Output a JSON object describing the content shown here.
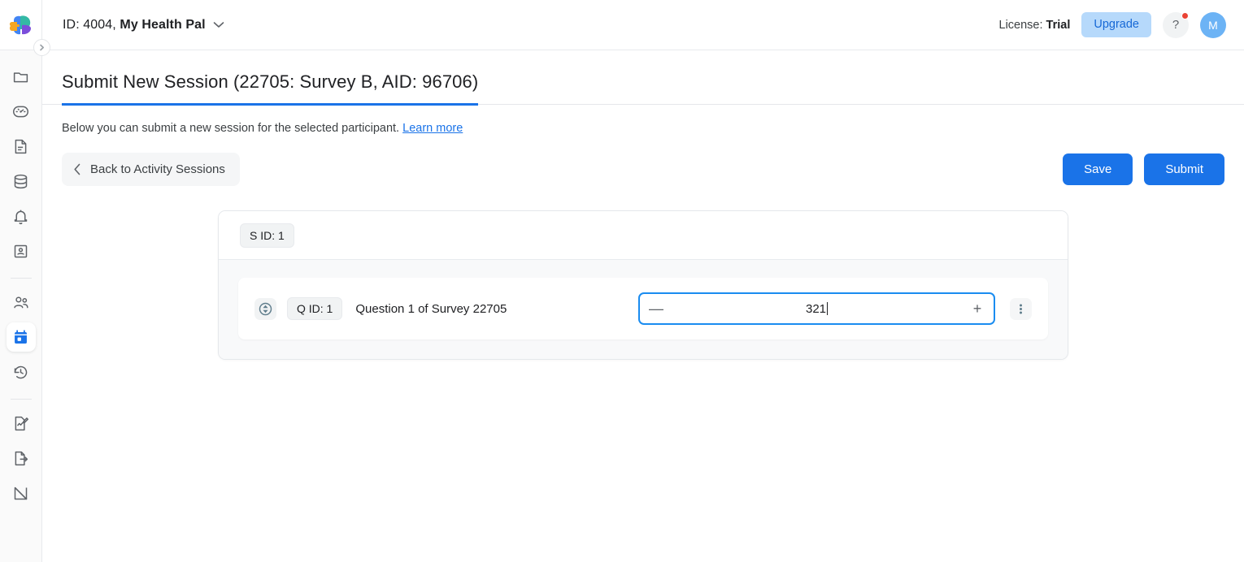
{
  "header": {
    "logo_icon": "brain-logo",
    "app_title_prefix": "ID: 4004,",
    "app_title_name": "My Health Pal",
    "dropdown_icon": "chevron-down-icon",
    "license_label": "License:",
    "license_value": "Trial",
    "upgrade_label": "Upgrade",
    "help_label": "?",
    "help_icon": "question-mark-icon",
    "avatar_initial": "M"
  },
  "sidebar": {
    "collapse_icon": "chevron-right-icon",
    "items": [
      {
        "name": "folder",
        "icon": "folder-icon",
        "active": false
      },
      {
        "name": "dashboard",
        "icon": "gauge-icon",
        "active": false
      },
      {
        "name": "documents",
        "icon": "document-icon",
        "active": false
      },
      {
        "name": "database",
        "icon": "database-icon",
        "active": false
      },
      {
        "name": "notifications",
        "icon": "bell-icon",
        "active": false
      },
      {
        "name": "participants",
        "icon": "id-card-icon",
        "active": false
      },
      {
        "name": "users",
        "icon": "users-icon",
        "active": false
      },
      {
        "name": "activity-sessions",
        "icon": "calendar-icon",
        "active": true
      },
      {
        "name": "history",
        "icon": "history-icon",
        "active": false
      },
      {
        "name": "edit-report",
        "icon": "document-edit-icon",
        "active": false
      },
      {
        "name": "export",
        "icon": "document-export-icon",
        "active": false
      },
      {
        "name": "analytics",
        "icon": "chart-icon",
        "active": false
      }
    ]
  },
  "page": {
    "title": "Submit New Session (22705: Survey B, AID: 96706)",
    "description": "Below you can submit a new session for the selected participant.",
    "learn_more_label": "Learn more",
    "back_label": "Back to Activity Sessions",
    "back_icon": "chevron-left-icon",
    "save_label": "Save",
    "submit_label": "Submit"
  },
  "session": {
    "session_badge": "S ID: 1",
    "questions": [
      {
        "drag_icon": "drag-handle-icon",
        "question_badge": "Q ID: 1",
        "question_text": "Question 1 of Survey 22705",
        "decrement_label": "—",
        "increment_label": "+",
        "value": "321",
        "menu_icon": "kebab-menu-icon"
      }
    ]
  },
  "colors": {
    "accent": "#1a73e8",
    "focus_border": "#1a8cf0",
    "upgrade_bg": "#b6d9fb",
    "badge_dot": "#ea4335",
    "avatar_bg": "#6cb3f5"
  }
}
